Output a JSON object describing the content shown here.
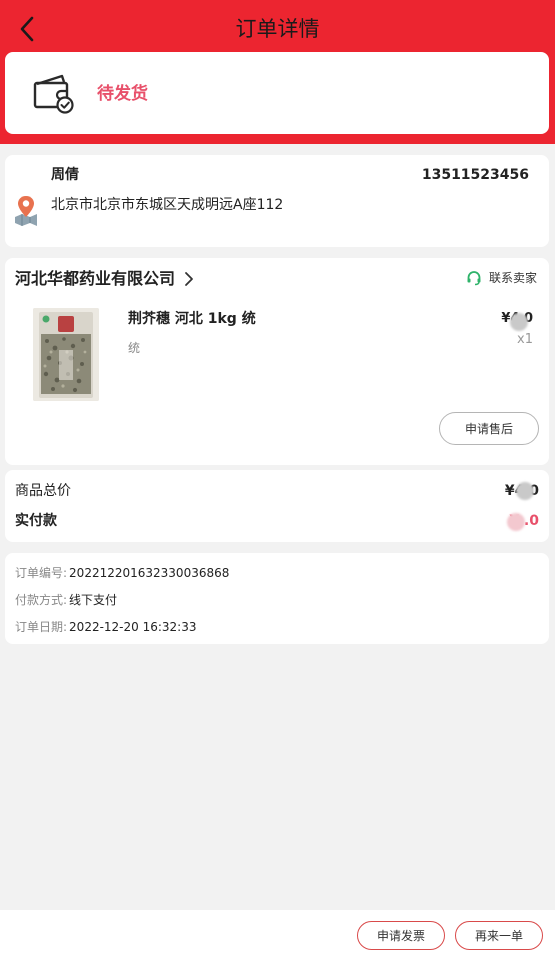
{
  "header": {
    "title": "订单详情",
    "back_icon": "chevron-left-icon"
  },
  "status": {
    "text": "待发货",
    "icon": "wallet-check-icon"
  },
  "address": {
    "name": "周倩",
    "phone": "13511523456",
    "line": "北京市北京市东城区天成明远A座112",
    "icon": "location-map-icon"
  },
  "shop": {
    "name": "河北华都药业有限公司",
    "contact_label": "联系卖家",
    "product": {
      "name": "荆芥穗 河北 1kg 统",
      "spec": "统",
      "price": "¥4  0",
      "qty": "x1"
    },
    "after_sale_label": "申请售后"
  },
  "totals": {
    "goods_label": "商品总价",
    "goods_value": "¥4  0",
    "paid_label": "实付款",
    "paid_value": "¥   .0"
  },
  "info": {
    "order_no_label": "订单编号:",
    "order_no": "202212201632330036868",
    "payment_label": "付款方式:",
    "payment": "线下支付",
    "date_label": "订单日期:",
    "date": "2022-12-20 16:32:33"
  },
  "actions": {
    "invoice_label": "申请发票",
    "reorder_label": "再来一单"
  },
  "colors": {
    "brand_red": "#ec2530",
    "status_pink": "#e8506a",
    "page_bg": "#f2f2f2"
  }
}
